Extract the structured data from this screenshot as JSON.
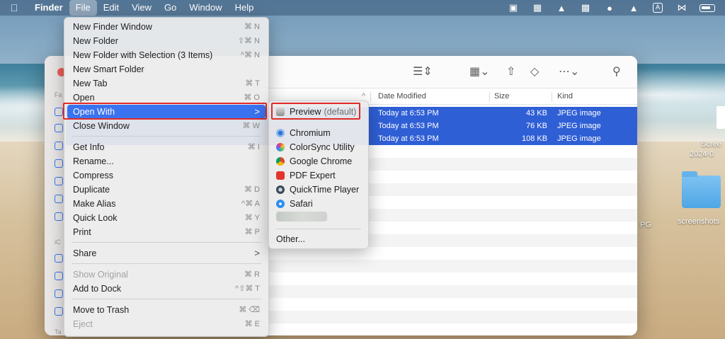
{
  "menubar": {
    "app_name": "Finder",
    "menus": [
      "File",
      "Edit",
      "View",
      "Go",
      "Window",
      "Help"
    ],
    "status_icons": [
      "crop-icon",
      "layout-icon",
      "penguin-icon",
      "grid-icon",
      "wechat-icon",
      "upload-icon",
      "text-input-icon",
      "bluetooth-icon",
      "battery-icon"
    ],
    "input_label": "A"
  },
  "file_menu": {
    "items": [
      {
        "label": "New Finder Window",
        "shortcut": "⌘ N"
      },
      {
        "label": "New Folder",
        "shortcut": "⇧⌘ N"
      },
      {
        "label": "New Folder with Selection (3 Items)",
        "shortcut": "^⌘ N"
      },
      {
        "label": "New Smart Folder",
        "shortcut": ""
      },
      {
        "label": "New Tab",
        "shortcut": "⌘ T"
      },
      {
        "label": "Open",
        "shortcut": "⌘ O"
      },
      {
        "label": "Open With",
        "shortcut": ">"
      },
      {
        "label": "Close Window",
        "shortcut": "⌘ W"
      },
      {
        "label": "Get Info",
        "shortcut": "⌘ I"
      },
      {
        "label": "Rename...",
        "shortcut": ""
      },
      {
        "label": "Compress",
        "shortcut": ""
      },
      {
        "label": "Duplicate",
        "shortcut": "⌘ D"
      },
      {
        "label": "Make Alias",
        "shortcut": "^⌘ A"
      },
      {
        "label": "Quick Look",
        "shortcut": "⌘ Y"
      },
      {
        "label": "Print",
        "shortcut": "⌘ P"
      },
      {
        "label": "Share",
        "shortcut": ">"
      },
      {
        "label": "Show Original",
        "shortcut": "⌘ R"
      },
      {
        "label": "Add to Dock",
        "shortcut": "^⇧⌘ T"
      },
      {
        "label": "Move to Trash",
        "shortcut": "⌘ ⌫"
      },
      {
        "label": "Eject",
        "shortcut": "⌘ E"
      }
    ]
  },
  "open_with_menu": {
    "default_app": "Preview",
    "default_suffix": "(default)",
    "apps": [
      "Chromium",
      "ColorSync Utility",
      "Google Chrome",
      "PDF Expert",
      "QuickTime Player",
      "Safari"
    ],
    "other": "Other..."
  },
  "finder": {
    "columns": [
      "Date Modified",
      "Size",
      "Kind"
    ],
    "rows": [
      {
        "date": "Today at 6:53 PM",
        "size": "43 KB",
        "kind": "JPEG image"
      },
      {
        "date": "Today at 6:53 PM",
        "size": "76 KB",
        "kind": "JPEG image"
      },
      {
        "date": "Today at 6:53 PM",
        "size": "108 KB",
        "kind": "JPEG image"
      }
    ],
    "sidebar_labels": [
      "Fa",
      "iC",
      "Ta"
    ]
  },
  "desktop": {
    "folder_label": "screenshots",
    "file_label_1": "Scree",
    "file_label_2": "2024-0",
    "partial_label": "PG"
  },
  "colors": {
    "highlight": "#3a73f0",
    "selection": "#2f5fd5",
    "annotation": "#e02a2a"
  }
}
